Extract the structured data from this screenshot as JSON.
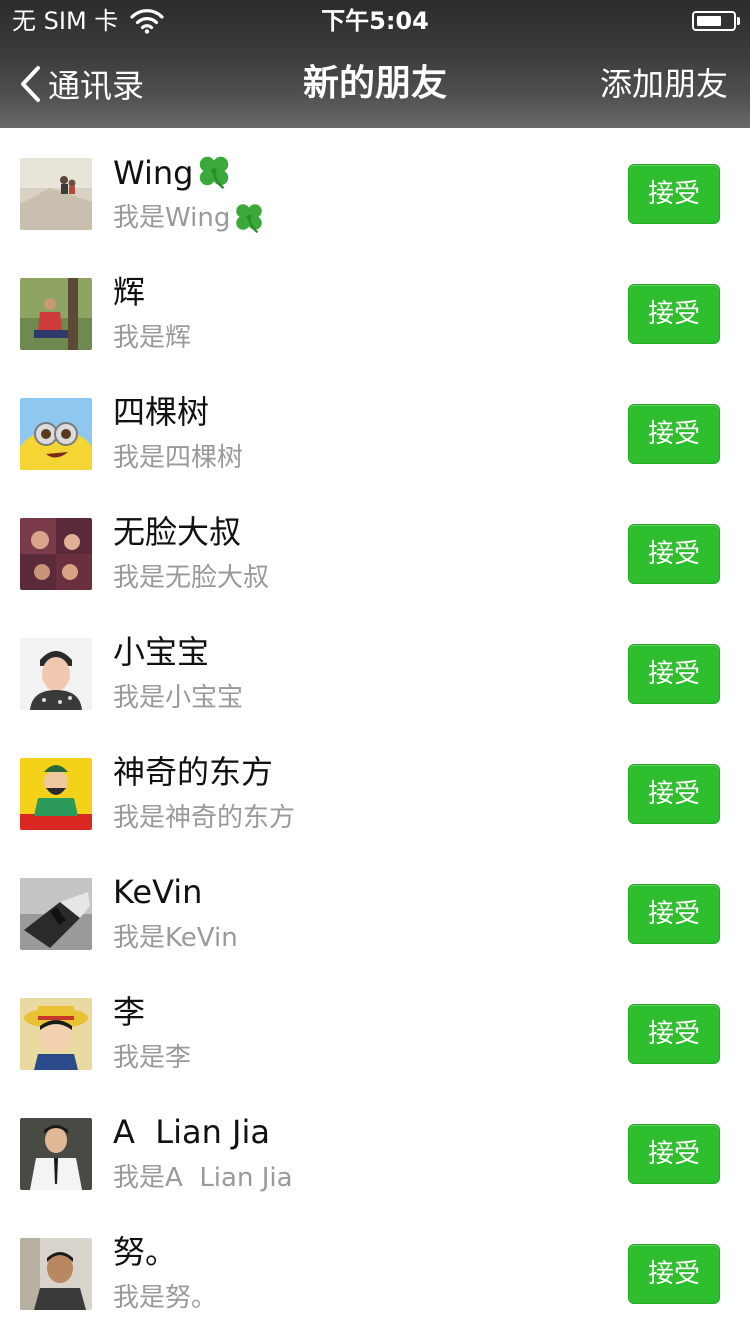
{
  "status_bar": {
    "carrier": "无 SIM 卡",
    "time": "下午5:04"
  },
  "nav": {
    "back_label": "通讯录",
    "title": "新的朋友",
    "action_label": "添加朋友"
  },
  "accept_color": "#2ebe2e",
  "requests": [
    {
      "name": "Wing",
      "message": "我是Wing",
      "has_clover": true,
      "accept_label": "接受"
    },
    {
      "name": "辉",
      "message": "我是辉",
      "has_clover": false,
      "accept_label": "接受"
    },
    {
      "name": "四棵树",
      "message": "我是四棵树",
      "has_clover": false,
      "accept_label": "接受"
    },
    {
      "name": "无脸大叔",
      "message": "我是无脸大叔",
      "has_clover": false,
      "accept_label": "接受"
    },
    {
      "name": "小宝宝",
      "message": "我是小宝宝",
      "has_clover": false,
      "accept_label": "接受"
    },
    {
      "name": "神奇的东方",
      "message": "我是神奇的东方",
      "has_clover": false,
      "accept_label": "接受"
    },
    {
      "name": "KeVin",
      "message": "我是KeVin",
      "has_clover": false,
      "accept_label": "接受"
    },
    {
      "name": "李",
      "message": "我是李",
      "has_clover": false,
      "accept_label": "接受"
    },
    {
      "name": "A  Lian Jia",
      "message": "我是A  Lian Jia",
      "has_clover": false,
      "accept_label": "接受"
    },
    {
      "name": "努。",
      "message": "我是努。",
      "has_clover": false,
      "accept_label": "接受"
    }
  ]
}
